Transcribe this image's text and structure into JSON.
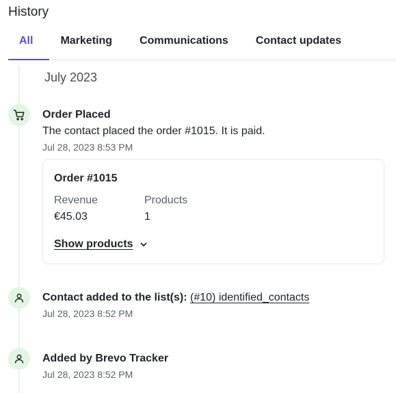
{
  "header": {
    "title": "History"
  },
  "tabs": [
    {
      "label": "All",
      "active": true
    },
    {
      "label": "Marketing",
      "active": false
    },
    {
      "label": "Communications",
      "active": false
    },
    {
      "label": "Contact updates",
      "active": false
    }
  ],
  "timeline": {
    "month": "July 2023",
    "events": [
      {
        "icon": "cart-icon",
        "title": "Order Placed",
        "description": "The contact placed the order #1015. It is paid.",
        "time": "Jul 28, 2023 8:53 PM",
        "order": {
          "title": "Order #1015",
          "revenue_label": "Revenue",
          "revenue_value": "€45.03",
          "products_label": "Products",
          "products_value": "1",
          "show_products_label": "Show products"
        }
      },
      {
        "icon": "user-icon",
        "title": "Contact added to the list(s):",
        "link": "(#10) identified_contacts",
        "time": "Jul 28, 2023 8:52 PM"
      },
      {
        "icon": "user-icon",
        "title": "Added by Brevo Tracker",
        "time": "Jul 28, 2023 8:52 PM"
      }
    ]
  },
  "colors": {
    "accent": "#5b4ed6",
    "timeline_green": "#e3f5e3",
    "icon_stroke": "#1f2328"
  }
}
